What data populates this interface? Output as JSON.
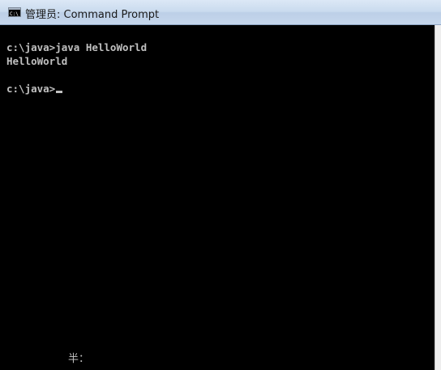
{
  "window": {
    "title": "管理员: Command Prompt",
    "icon": "cmd-icon"
  },
  "console": {
    "lines": [
      "c:\\java>java HelloWorld",
      "HelloWorld",
      "",
      "c:\\java>"
    ],
    "ime_status": "半："
  },
  "colors": {
    "titlebar": "#c9daee",
    "console_bg": "#000000",
    "console_text": "#c0c0c0"
  }
}
